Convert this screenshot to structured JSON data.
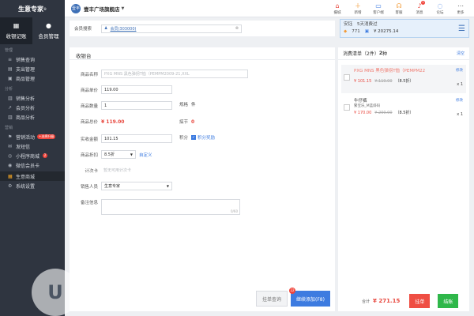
{
  "app": {
    "logo": "生意专家",
    "logo_sup": "®"
  },
  "sidebar": {
    "tabs": [
      {
        "label": "收银记账"
      },
      {
        "label": "会员管理"
      }
    ],
    "sections": [
      {
        "title": "管理"
      },
      {
        "title": "分析"
      },
      {
        "title": "营销"
      }
    ],
    "items": [
      {
        "label": "销售查询"
      },
      {
        "label": "支出管理"
      },
      {
        "label": "商品管理"
      },
      {
        "label": "销售分析"
      },
      {
        "label": "会员分析"
      },
      {
        "label": "商品分析"
      },
      {
        "label": "营销活动",
        "badge": "+选择升级"
      },
      {
        "label": "发短信"
      },
      {
        "label": "小程序商城",
        "badge": "2"
      },
      {
        "label": "微信会员卡"
      },
      {
        "label": "生意商城"
      },
      {
        "label": "系统设置"
      }
    ]
  },
  "topbar": {
    "store_logo": "壹丰",
    "store_name": "壹丰广场旗舰店",
    "icons": [
      {
        "label": "摄城",
        "icon": "shop-icon"
      },
      {
        "label": "新增",
        "icon": "plus-icon"
      },
      {
        "label": "客户端",
        "icon": "monitor-icon"
      },
      {
        "label": "客服",
        "icon": "headset-icon"
      },
      {
        "label": "消息",
        "icon": "bell-icon",
        "badge": "1"
      },
      {
        "label": "论坛",
        "icon": "chat-icon"
      },
      {
        "label": "更多",
        "icon": "grid-icon"
      }
    ]
  },
  "member": {
    "label": "会员搜索",
    "value": "会员(303000)"
  },
  "balance": {
    "title": "安钰",
    "days": "5天消费过",
    "points": "771",
    "amount": "¥ 20275.14"
  },
  "cashier": {
    "title": "收银台",
    "fields": {
      "product_name_label": "商品名称",
      "product_name_placeholder": "PXG MNS 黑色弹拐T恤（PEMPM2009-21,XXL",
      "unit_price_label": "商品单价",
      "unit_price_value": "119.00",
      "qty_label": "商品数量",
      "qty_value": "1",
      "spec_label": "规格",
      "spec_value": "件",
      "total_label": "商品总价",
      "total_value": "¥ 119.00",
      "discount_amt_label": "搞节",
      "discount_amt_value": "0",
      "paid_label": "实收金额",
      "paid_value": "101.15",
      "points_label": "积分",
      "points_check": "积分奖励",
      "discount_label": "商品折扣",
      "discount_value": "8.5折",
      "custom_link": "自定义",
      "card_label": "计次卡",
      "card_placeholder": "暂无可用计次卡",
      "staff_label": "销售人员",
      "staff_value": "生意专家",
      "remark_label": "备注信息",
      "remark_count": "0/60"
    },
    "hold_button": "挂单查询",
    "continue_button": "继续添加(F8)",
    "continue_badge": "22"
  },
  "orders": {
    "title": "消费清单",
    "count_prefix": "（2件）",
    "count_kinds": "2",
    "count_suffix": "种",
    "clear": "清空",
    "items": [
      {
        "name": "PXG MNS 黑色弹拐T恤（PEMPM22",
        "now": "¥ 101.15",
        "old": "¥ 119.00",
        "disc": "（8.5折）",
        "edit": "修改",
        "qty": "x 1"
      },
      {
        "name": "牛仔裤",
        "sub": "繁宝乐_M蓝斜码",
        "now": "¥ 170.00",
        "old": "¥ 200.00",
        "disc": "（8.5折）",
        "edit": "修改",
        "qty": "x 1"
      }
    ],
    "total_label": "合计",
    "total": "¥ 271.15",
    "hang_button": "挂单",
    "settle_button": "结账"
  }
}
